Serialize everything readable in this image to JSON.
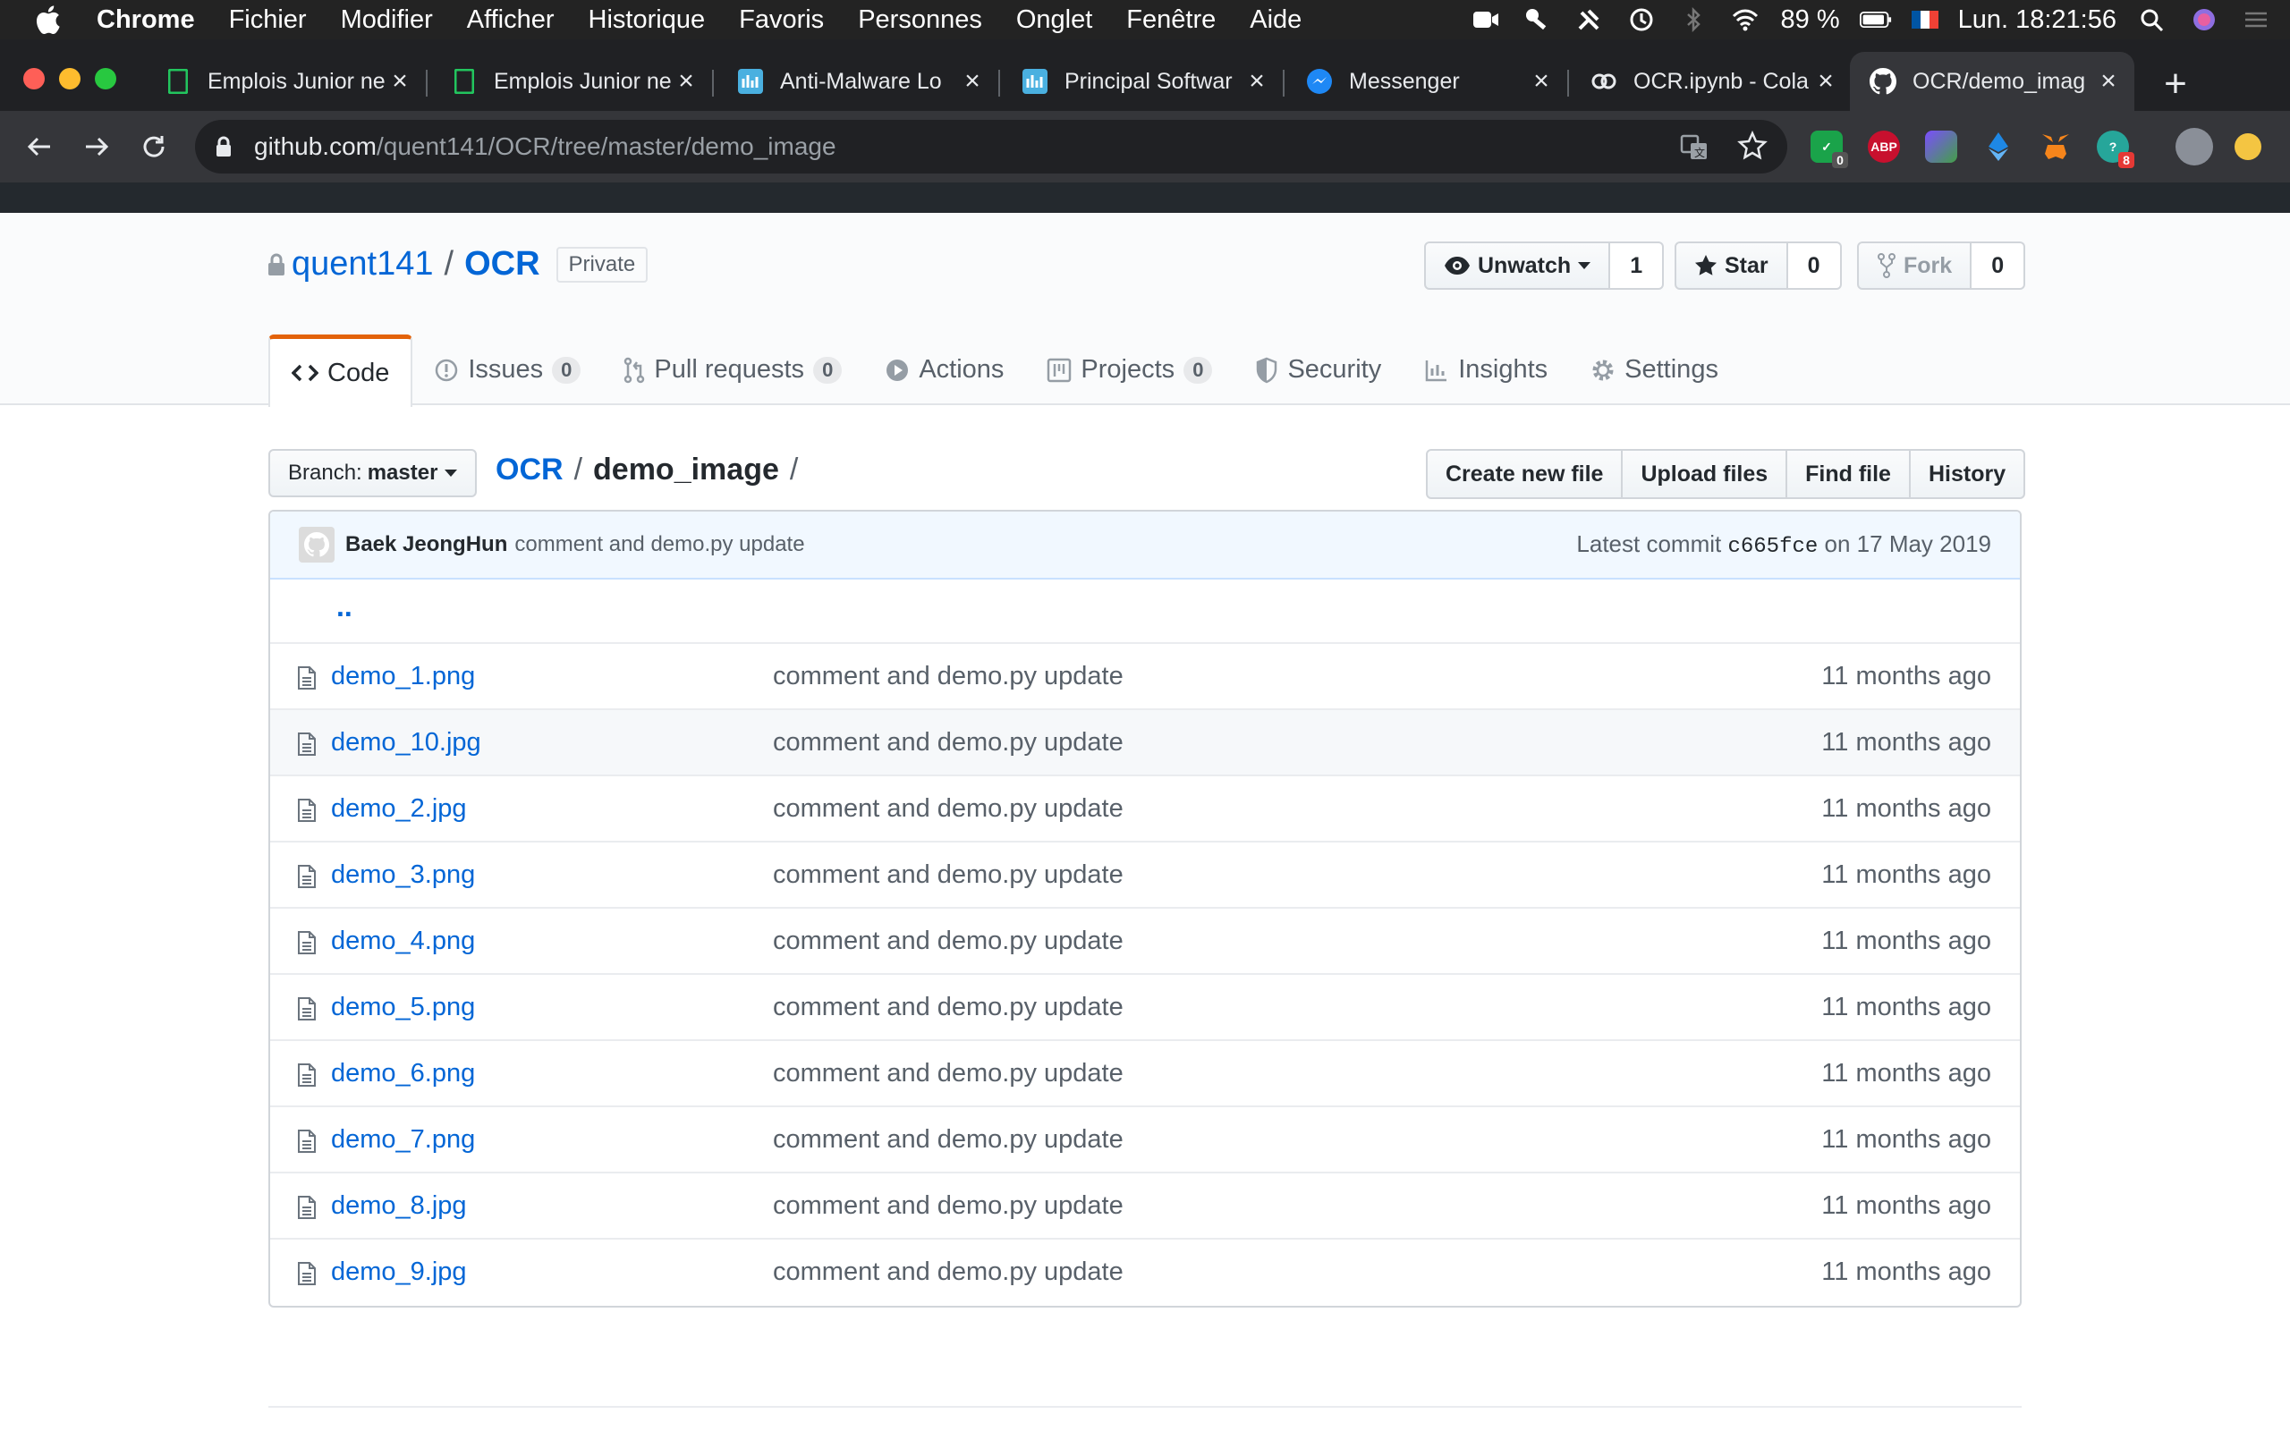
{
  "menubar": {
    "app_name": "Chrome",
    "items": [
      "Fichier",
      "Modifier",
      "Afficher",
      "Historique",
      "Favoris",
      "Personnes",
      "Onglet",
      "Fenêtre",
      "Aide"
    ],
    "battery_percent": "89 %",
    "clock": "Lun. 18:21:56"
  },
  "tabs": [
    {
      "title": "Emplois Junior ne",
      "favicon": "green-doc-icon"
    },
    {
      "title": "Emplois Junior ne",
      "favicon": "green-doc-icon"
    },
    {
      "title": "Anti-Malware Lo",
      "favicon": "chart-icon"
    },
    {
      "title": "Principal Softwar",
      "favicon": "chart-icon"
    },
    {
      "title": "Messenger",
      "favicon": "messenger-icon"
    },
    {
      "title": "OCR.ipynb - Cola",
      "favicon": "colab-icon"
    },
    {
      "title": "OCR/demo_imag",
      "favicon": "github-icon",
      "active": true
    }
  ],
  "toolbar": {
    "url_host": "github.com",
    "url_path": "/quent141/OCR/tree/master/demo_image",
    "extension_badges": {
      "ext1": "0",
      "ext2": "8"
    },
    "abp_label": "ABP"
  },
  "repo": {
    "owner": "quent141",
    "name": "OCR",
    "visibility": "Private",
    "watch_label": "Unwatch",
    "watch_count": "1",
    "star_label": "Star",
    "star_count": "0",
    "fork_label": "Fork",
    "fork_count": "0"
  },
  "nav": {
    "code": "Code",
    "issues": "Issues",
    "issues_count": "0",
    "pulls": "Pull requests",
    "pulls_count": "0",
    "actions": "Actions",
    "projects": "Projects",
    "projects_count": "0",
    "security": "Security",
    "insights": "Insights",
    "settings": "Settings"
  },
  "breadcrumb": {
    "branch_prefix": "Branch:",
    "branch": "master",
    "root": "OCR",
    "folder": "demo_image",
    "trailing_slash": "/"
  },
  "file_actions": [
    "Create new file",
    "Upload files",
    "Find file",
    "History"
  ],
  "commit": {
    "author": "Baek JeongHun",
    "message": "comment and demo.py update",
    "latest_prefix": "Latest commit",
    "sha": "c665fce",
    "date": "on 17 May 2019"
  },
  "parent_dir": "..",
  "files": [
    {
      "name": "demo_1.png",
      "message": "comment and demo.py update",
      "age": "11 months ago"
    },
    {
      "name": "demo_10.jpg",
      "message": "comment and demo.py update",
      "age": "11 months ago"
    },
    {
      "name": "demo_2.jpg",
      "message": "comment and demo.py update",
      "age": "11 months ago"
    },
    {
      "name": "demo_3.png",
      "message": "comment and demo.py update",
      "age": "11 months ago"
    },
    {
      "name": "demo_4.png",
      "message": "comment and demo.py update",
      "age": "11 months ago"
    },
    {
      "name": "demo_5.png",
      "message": "comment and demo.py update",
      "age": "11 months ago"
    },
    {
      "name": "demo_6.png",
      "message": "comment and demo.py update",
      "age": "11 months ago"
    },
    {
      "name": "demo_7.png",
      "message": "comment and demo.py update",
      "age": "11 months ago"
    },
    {
      "name": "demo_8.jpg",
      "message": "comment and demo.py update",
      "age": "11 months ago"
    },
    {
      "name": "demo_9.jpg",
      "message": "comment and demo.py update",
      "age": "11 months ago"
    }
  ],
  "colors": {
    "link": "#0366d6",
    "tab_underline": "#e36209",
    "commit_bar": "#f1f8ff"
  }
}
